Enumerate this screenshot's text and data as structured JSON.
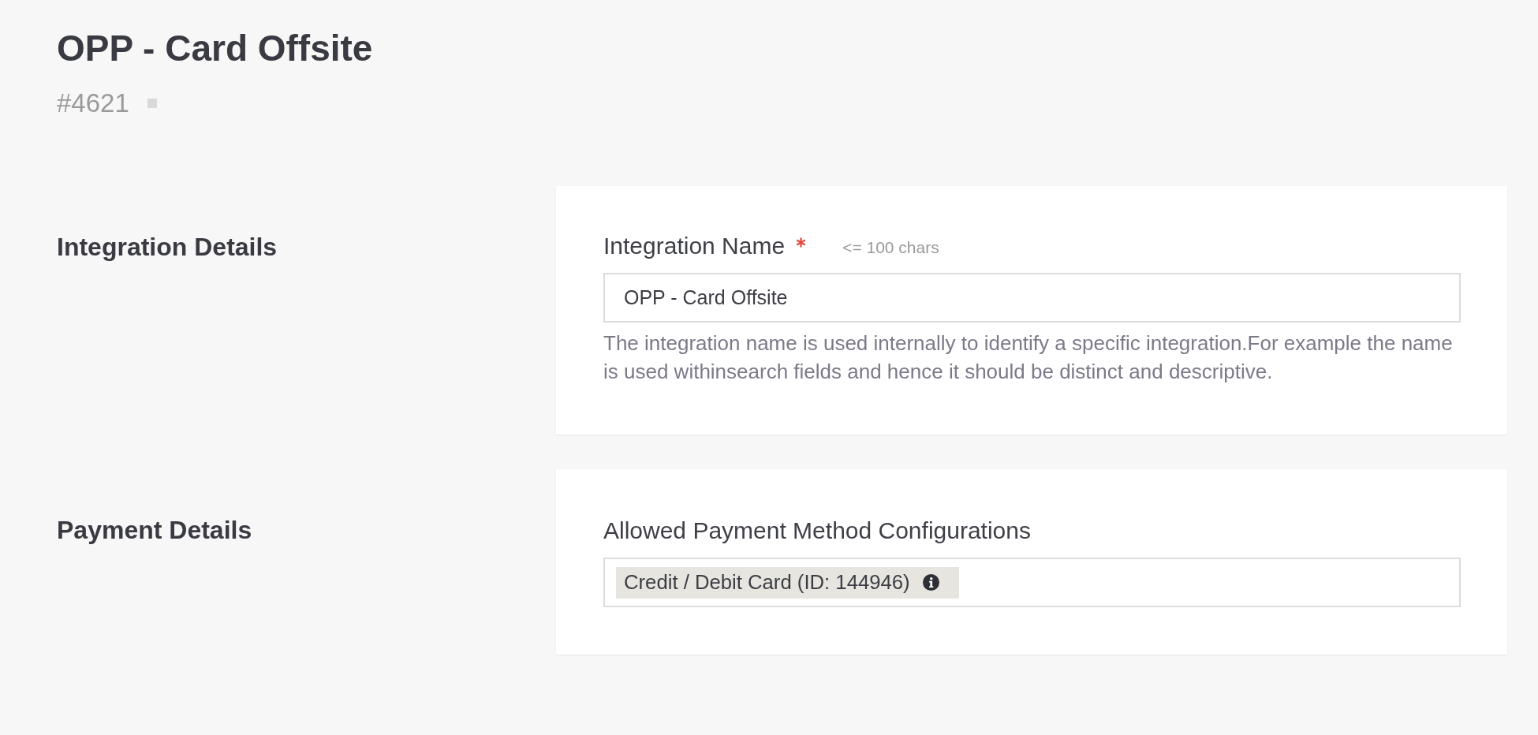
{
  "page": {
    "title": "OPP - Card Offsite",
    "number": "#4621"
  },
  "sections": [
    {
      "heading": "Integration Details",
      "fields": [
        {
          "kind": "text",
          "label": "Integration Name",
          "required": true,
          "hint": "<= 100 chars",
          "value": "OPP - Card Offsite",
          "description": "The integration name is used internally to identify a specific integration.For example the name is used withinsearch fields and hence it should be distinct and descriptive."
        }
      ]
    },
    {
      "heading": "Payment Details",
      "fields": [
        {
          "kind": "tags",
          "label": "Allowed Payment Method Configurations",
          "required": false,
          "tags": [
            {
              "label": "Credit / Debit Card (ID: 144946)"
            }
          ]
        }
      ]
    }
  ]
}
